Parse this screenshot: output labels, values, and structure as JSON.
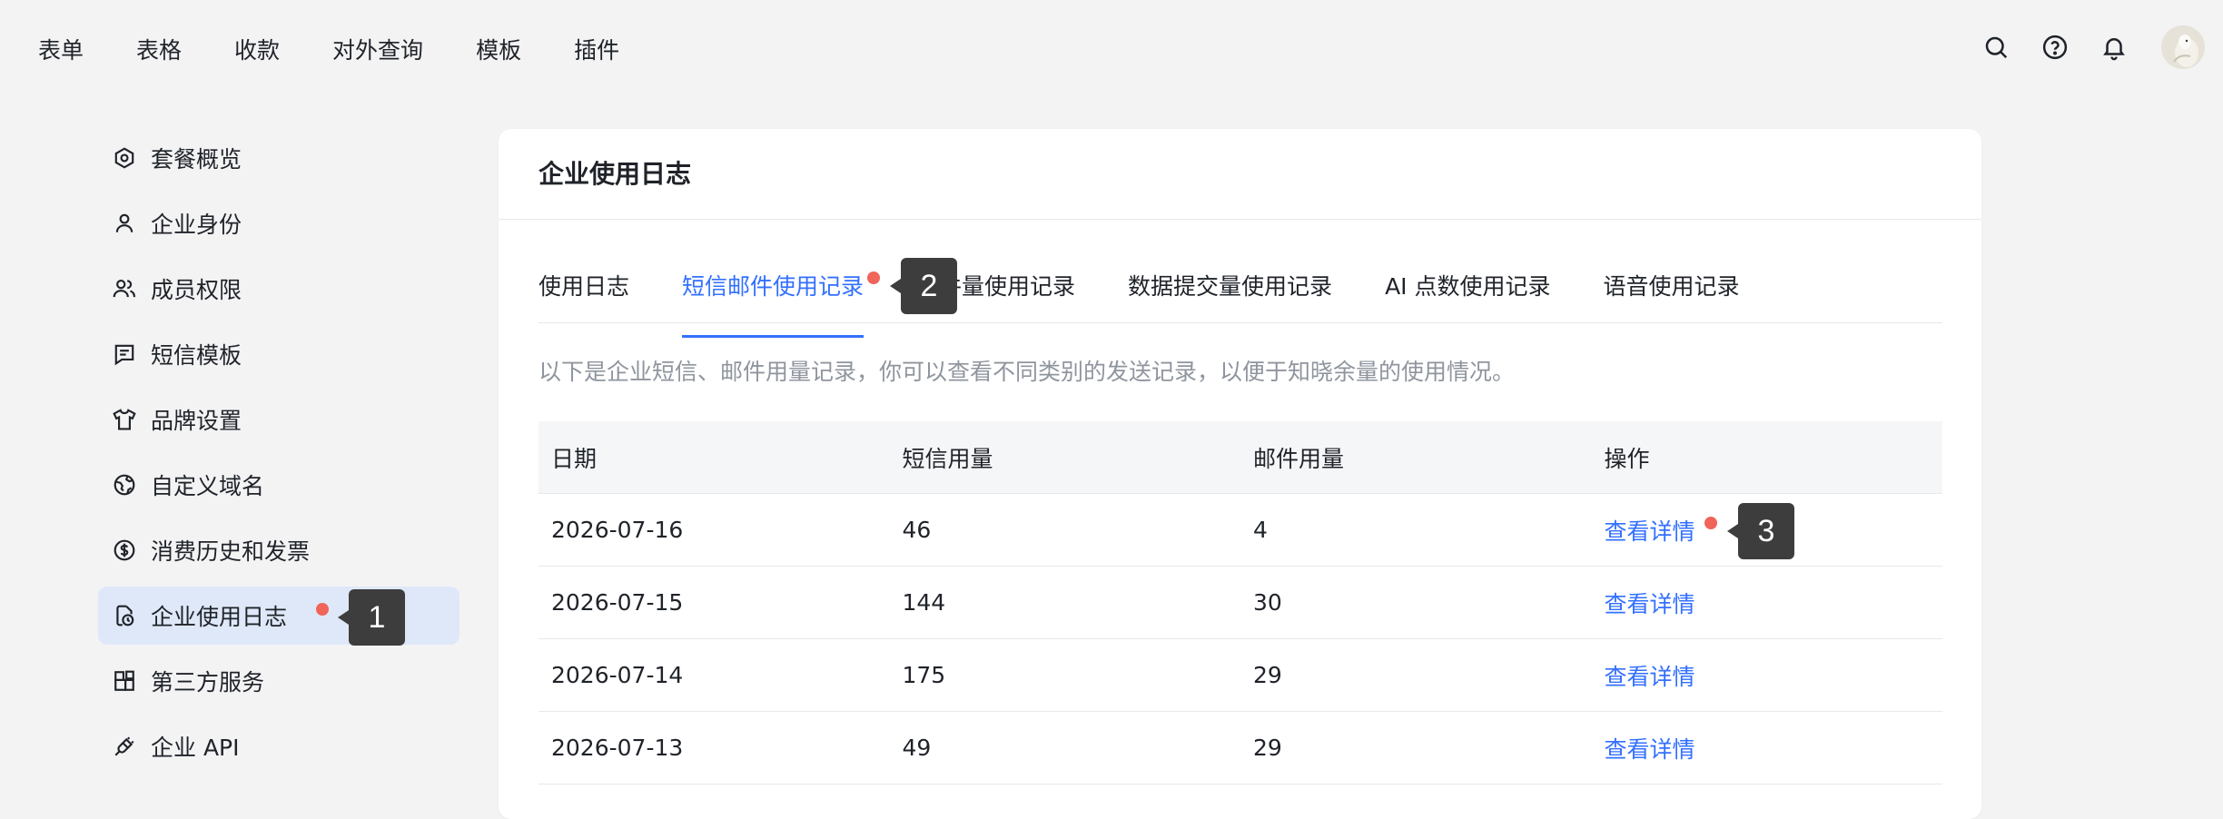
{
  "topnav": {
    "menu": [
      "表单",
      "表格",
      "收款",
      "对外查询",
      "模板",
      "插件"
    ],
    "icons": [
      "search-icon",
      "help-icon",
      "bell-icon"
    ]
  },
  "sidebar": {
    "items": [
      {
        "label": "套餐概览",
        "icon": "package-icon"
      },
      {
        "label": "企业身份",
        "icon": "user-icon"
      },
      {
        "label": "成员权限",
        "icon": "users-icon"
      },
      {
        "label": "短信模板",
        "icon": "message-icon"
      },
      {
        "label": "品牌设置",
        "icon": "shirt-icon"
      },
      {
        "label": "自定义域名",
        "icon": "globe-icon"
      },
      {
        "label": "消费历史和发票",
        "icon": "dollar-icon"
      },
      {
        "label": "企业使用日志",
        "icon": "log-icon",
        "active": true
      },
      {
        "label": "第三方服务",
        "icon": "apps-icon"
      },
      {
        "label": "企业 API",
        "icon": "plug-icon"
      }
    ]
  },
  "main": {
    "title": "企业使用日志",
    "tabs": [
      "使用日志",
      "短信邮件使用记录",
      "附件量使用记录",
      "数据提交量使用记录",
      "AI 点数使用记录",
      "语音使用记录"
    ],
    "active_tab": 1,
    "description": "以下是企业短信、邮件用量记录，你可以查看不同类别的发送记录，以便于知晓余量的使用情况。",
    "table": {
      "headers": [
        "日期",
        "短信用量",
        "邮件用量",
        "操作"
      ],
      "rows": [
        {
          "date": "2026-07-16",
          "sms": "46",
          "email": "4",
          "action": "查看详情"
        },
        {
          "date": "2026-07-15",
          "sms": "144",
          "email": "30",
          "action": "查看详情"
        },
        {
          "date": "2026-07-14",
          "sms": "175",
          "email": "29",
          "action": "查看详情"
        },
        {
          "date": "2026-07-13",
          "sms": "49",
          "email": "29",
          "action": "查看详情"
        }
      ]
    }
  },
  "markers": [
    "1",
    "2",
    "3"
  ],
  "colors": {
    "accent": "#3370ff",
    "active_bg": "#dfe8f8",
    "marker_dot": "#f0645a"
  }
}
